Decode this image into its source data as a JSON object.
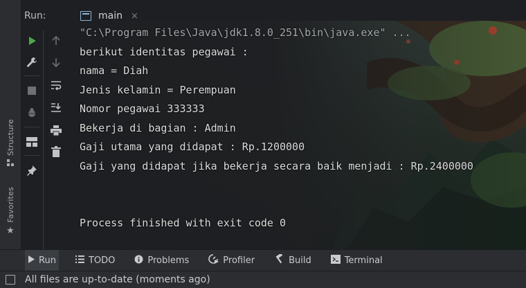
{
  "run_panel": {
    "label": "Run:",
    "tab": {
      "label": "main",
      "close": "×"
    }
  },
  "left_strip": {
    "structure": "Structure",
    "favorites": "Favorites"
  },
  "toolbar": {
    "icons": [
      "run-icon",
      "wrench-icon",
      "stop-icon",
      "debug-icon",
      "layout-icon",
      "pin-icon"
    ],
    "icons2": [
      "scroll-up-icon",
      "scroll-down-icon",
      "soft-wrap-icon",
      "scroll-to-end-icon",
      "print-icon",
      "trash-icon"
    ],
    "colors": {
      "run": "#4ca84c",
      "accent": "#3574f0"
    }
  },
  "console": {
    "command": "\"C:\\Program Files\\Java\\jdk1.8.0_251\\bin\\java.exe\" ...",
    "output": [
      "berikut identitas pegawai :",
      "nama = Diah",
      "Jenis kelamin = Perempuan",
      "Nomor pegawai 333333",
      "Bekerja di bagian : Admin",
      "Gaji utama yang didapat : Rp.1200000",
      "Gaji yang didapat jika bekerja secara baik menjadi : Rp.2400000"
    ],
    "exit": "Process finished with exit code 0"
  },
  "bottom_tabs": [
    {
      "label": "Run",
      "icon": "play-icon"
    },
    {
      "label": "TODO",
      "icon": "list-icon"
    },
    {
      "label": "Problems",
      "icon": "info-icon"
    },
    {
      "label": "Profiler",
      "icon": "profiler-icon"
    },
    {
      "label": "Build",
      "icon": "hammer-icon"
    },
    {
      "label": "Terminal",
      "icon": "terminal-icon"
    }
  ],
  "status": {
    "message": "All files are up-to-date (moments ago)"
  }
}
